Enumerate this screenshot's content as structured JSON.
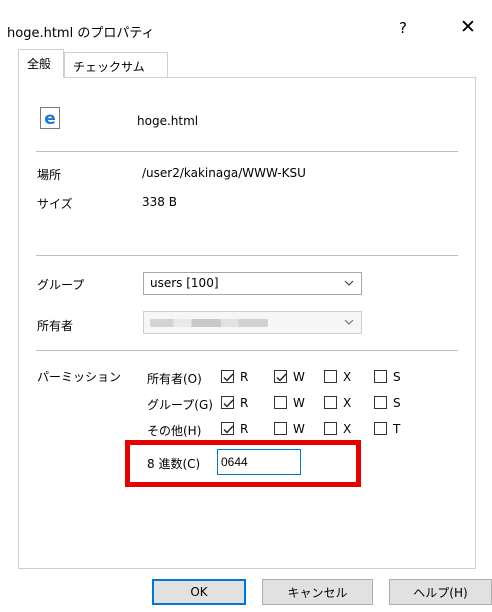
{
  "window": {
    "title": "hoge.html のプロパティ",
    "help_glyph": "?",
    "close_glyph": "✕"
  },
  "tabs": [
    {
      "label": "全般",
      "active": true
    },
    {
      "label": "チェックサム",
      "active": false
    }
  ],
  "file": {
    "icon": "html-file-icon",
    "name": "hoge.html",
    "location_label": "場所",
    "location": "/user2/kakinaga/WWW-KSU",
    "size_label": "サイズ",
    "size": "338 B"
  },
  "group": {
    "label": "グループ",
    "value": "users [100]"
  },
  "owner": {
    "label": "所有者",
    "value_obscured": true
  },
  "permissions": {
    "label": "パーミッション",
    "rows": [
      {
        "label": "所有者(O)",
        "r": true,
        "w": true,
        "x": false,
        "extra": "S",
        "extra_checked": false
      },
      {
        "label": "グループ(G)",
        "r": true,
        "w": false,
        "x": false,
        "extra": "S",
        "extra_checked": false
      },
      {
        "label": "その他(H)",
        "r": true,
        "w": false,
        "x": false,
        "extra": "T",
        "extra_checked": false
      }
    ],
    "r_label": "R",
    "w_label": "W",
    "x_label": "X",
    "octal_label": "8 進数(C)",
    "octal_value": "0644"
  },
  "buttons": {
    "ok": "OK",
    "cancel": "キャンセル",
    "help": "ヘルプ(H)"
  },
  "colors": {
    "highlight": "#e60000",
    "focus": "#0078d7",
    "ie_blue": "#1e78d2"
  }
}
